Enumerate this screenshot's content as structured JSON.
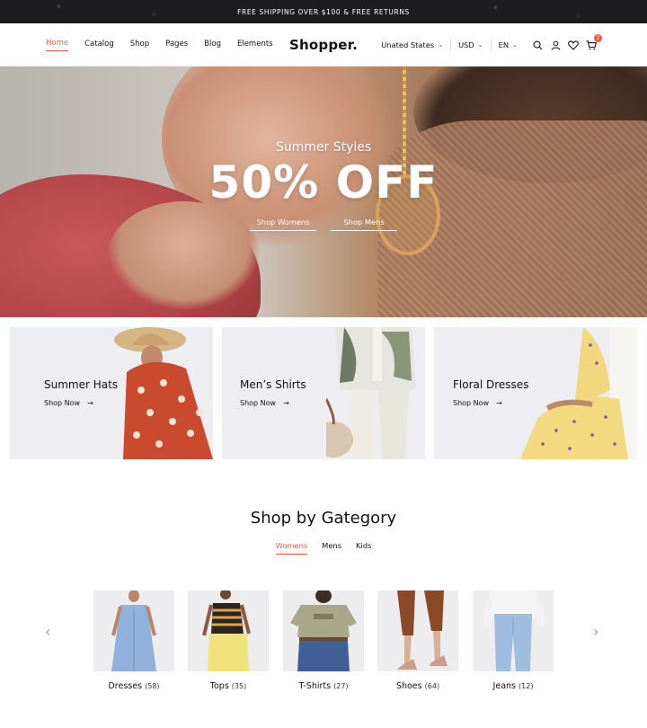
{
  "announcement": "FREE SHIPPING OVER $100 & FREE RETURNS",
  "header": {
    "nav": [
      "Home",
      "Catalog",
      "Shop",
      "Pages",
      "Blog",
      "Elements"
    ],
    "logo": "Shopper.",
    "country": "Unated States",
    "currency": "USD",
    "language": "EN",
    "cart_count": "2"
  },
  "hero": {
    "subtitle": "Summer Styles",
    "title": "50% OFF",
    "link_women": "Shop Womens",
    "link_men": "Shop Mens"
  },
  "promo_cards": [
    {
      "title": "Summer Hats",
      "link": "Shop Now",
      "arrow": "→"
    },
    {
      "title": "Men’s Shirts",
      "link": "Shop Now",
      "arrow": "→"
    },
    {
      "title": "Floral Dresses",
      "link": "Shop Now",
      "arrow": "→"
    }
  ],
  "categories": {
    "title": "Shop by Gategory",
    "tabs": [
      "Womens",
      "Mens",
      "Kids"
    ],
    "active_tab": "Womens",
    "items": [
      {
        "name": "Dresses",
        "count": "(58)"
      },
      {
        "name": "Tops",
        "count": "(35)"
      },
      {
        "name": "T-Shirts",
        "count": "(27)"
      },
      {
        "name": "Shoes",
        "count": "(64)"
      },
      {
        "name": "Jeans",
        "count": "(12)"
      }
    ],
    "prev_arrow": "‹",
    "next_arrow": "›"
  },
  "colors": {
    "accent": "#f05a3c",
    "topbar": "#1d1d1f",
    "card_bg": "#eeeef2"
  },
  "icons": [
    "search-icon",
    "user-icon",
    "heart-icon",
    "cart-icon",
    "arrow-right-icon",
    "chevron-left-icon",
    "chevron-right-icon"
  ]
}
